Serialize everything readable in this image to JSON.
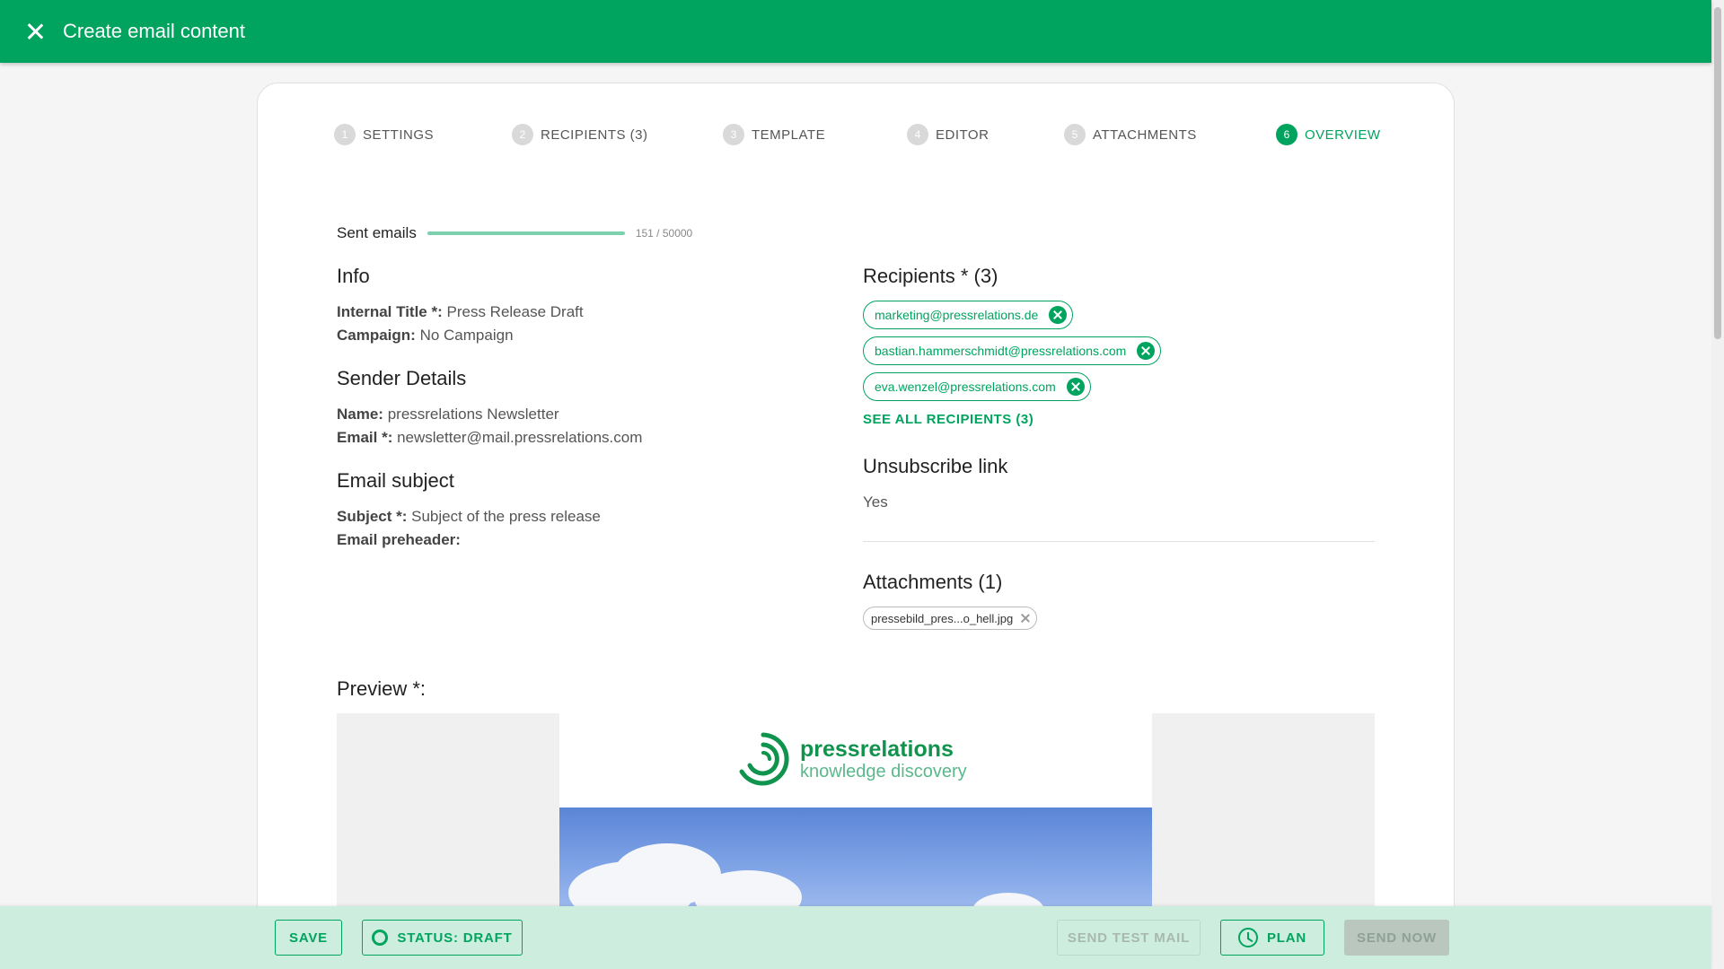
{
  "header": {
    "title": "Create email content"
  },
  "colors": {
    "accent": "#00a45f",
    "bottom_bar": "#cdeede"
  },
  "stepper": [
    {
      "num": "1",
      "label": "SETTINGS"
    },
    {
      "num": "2",
      "label": "RECIPIENTS (3)"
    },
    {
      "num": "3",
      "label": "TEMPLATE"
    },
    {
      "num": "4",
      "label": "EDITOR"
    },
    {
      "num": "5",
      "label": "ATTACHMENTS"
    },
    {
      "num": "6",
      "label": "OVERVIEW",
      "active": true
    }
  ],
  "sent": {
    "label": "Sent emails",
    "count": "151 / 50000",
    "fill_fraction": 1.0
  },
  "info": {
    "heading": "Info",
    "internal_title_label": "Internal Title *:",
    "internal_title": "Press Release Draft",
    "campaign_label": "Campaign:",
    "campaign": "No Campaign"
  },
  "sender": {
    "heading": "Sender Details",
    "name_label": "Name:",
    "name": "pressrelations Newsletter",
    "email_label": "Email *:",
    "email": "newsletter@mail.pressrelations.com"
  },
  "subject": {
    "heading": "Email subject",
    "subject_label": "Subject *:",
    "subject": "Subject of the press release",
    "preheader_label": "Email preheader:",
    "preheader": ""
  },
  "recipients": {
    "heading": "Recipients * (3)",
    "items": [
      "marketing@pressrelations.de",
      "bastian.hammerschmidt@pressrelations.com",
      "eva.wenzel@pressrelations.com"
    ],
    "see_all": "SEE ALL RECIPIENTS (3)"
  },
  "unsubscribe": {
    "heading": "Unsubscribe link",
    "value": "Yes"
  },
  "attachments": {
    "heading": "Attachments  (1)",
    "items": [
      "pressebild_pres...o_hell.jpg"
    ]
  },
  "preview": {
    "heading": "Preview *:",
    "logo_name": "pressrelations",
    "logo_tagline": "knowledge discovery"
  },
  "actions": {
    "save": "SAVE",
    "status": "STATUS: DRAFT",
    "send_test": "SEND TEST MAIL",
    "plan": "PLAN",
    "send_now": "SEND NOW"
  },
  "icons": {
    "close": "close-icon",
    "chip_remove": "cancel-circle-icon",
    "status": "ring-icon",
    "plan": "clock-icon"
  }
}
